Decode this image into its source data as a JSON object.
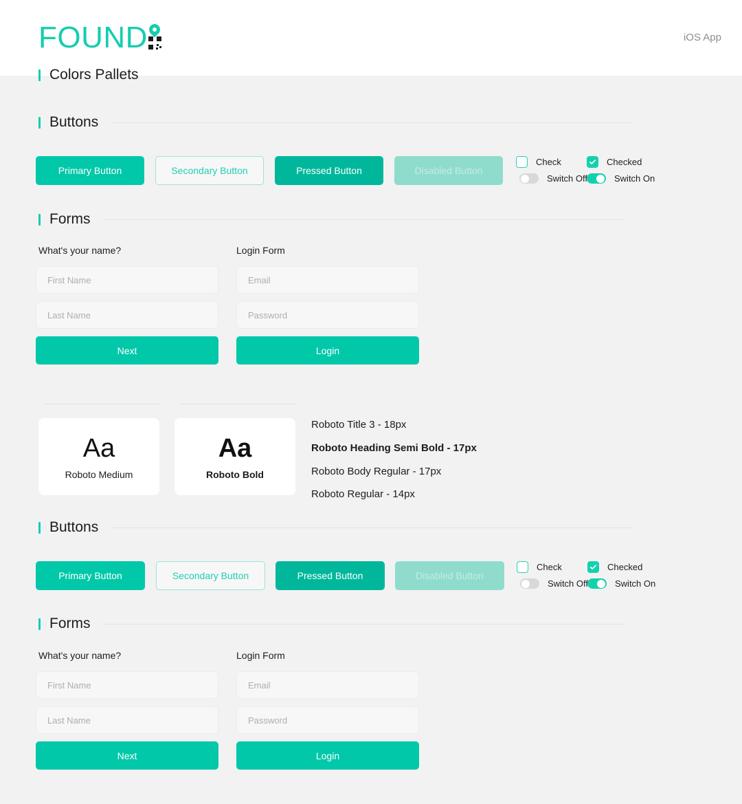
{
  "header": {
    "logo_text": "FOUND",
    "logo_pin_icon": "map-pin-icon",
    "logo_qr_icon": "qr-code-icon",
    "platform_label": "iOS App"
  },
  "colors": {
    "primary": "#00c8a9",
    "pressed": "#00b79c",
    "disabled": "#8fdccd",
    "secondary_text": "#21cfb3",
    "accent_bar": "#16cdb0",
    "switch_on": "#14d1ae",
    "switch_off": "#d8d8d8",
    "page_bg": "#f2f2f2",
    "field_bg": "#f7f7f7"
  },
  "sections": {
    "colors_pallets_title": "Colors Pallets",
    "buttons_title": "Buttons",
    "forms_title": "Forms"
  },
  "buttons": {
    "primary": "Primary Button",
    "secondary": "Secondary Button",
    "pressed": "Pressed Button",
    "disabled": "Disabled Button"
  },
  "controls": {
    "check": "Check",
    "checked": "Checked",
    "switch_off": "Switch Off",
    "switch_on": "Switch On"
  },
  "forms": {
    "name_form_label": "What's your name?",
    "login_form_label": "Login Form",
    "first_name_placeholder": "First Name",
    "last_name_placeholder": "Last Name",
    "email_placeholder": "Email",
    "password_placeholder": "Password",
    "next_button": "Next",
    "login_button": "Login"
  },
  "typography": {
    "sample_glyph": "Aa",
    "medium_name": "Roboto Medium",
    "bold_name": "Roboto Bold",
    "scale": [
      "Roboto Title 3 - 18px",
      "Roboto Heading Semi Bold - 17px",
      "Roboto Body Regular - 17px",
      "Roboto Regular - 14px"
    ]
  }
}
